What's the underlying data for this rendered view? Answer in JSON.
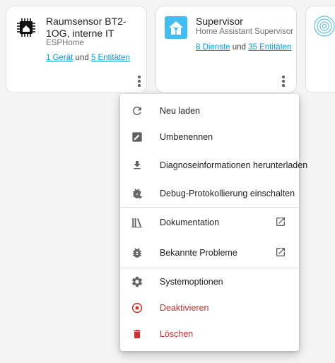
{
  "cards": [
    {
      "title": "Raumsensor BT2-1OG, interne IT",
      "subtitle": "ESPHome",
      "link1": "1 Gerät",
      "link_joiner": " und ",
      "link2": "5 Entitäten"
    },
    {
      "title": "Supervisor",
      "subtitle": "Home Assistant Supervisor",
      "link1": "8 Dienste",
      "link_joiner": " und ",
      "link2": "35 Entitäten"
    }
  ],
  "menu": {
    "reload": "Neu laden",
    "rename": "Umbenennen",
    "download_diagnostics": "Diagnoseinformationen herunterladen",
    "enable_debug": "Debug-Protokollierung einschalten",
    "documentation": "Dokumentation",
    "known_issues": "Bekannte Probleme",
    "system_options": "Systemoptionen",
    "disable": "Deaktivieren",
    "delete": "Löschen"
  },
  "colors": {
    "link": "#039be5",
    "danger": "#d32f2f",
    "icon": "#616161",
    "supervisor_tile": "#41bdf5"
  },
  "icons": {
    "card1": "esphome-chip-icon",
    "card2": "supervisor-house-icon",
    "card3": "partial-integration-logo-icon"
  }
}
